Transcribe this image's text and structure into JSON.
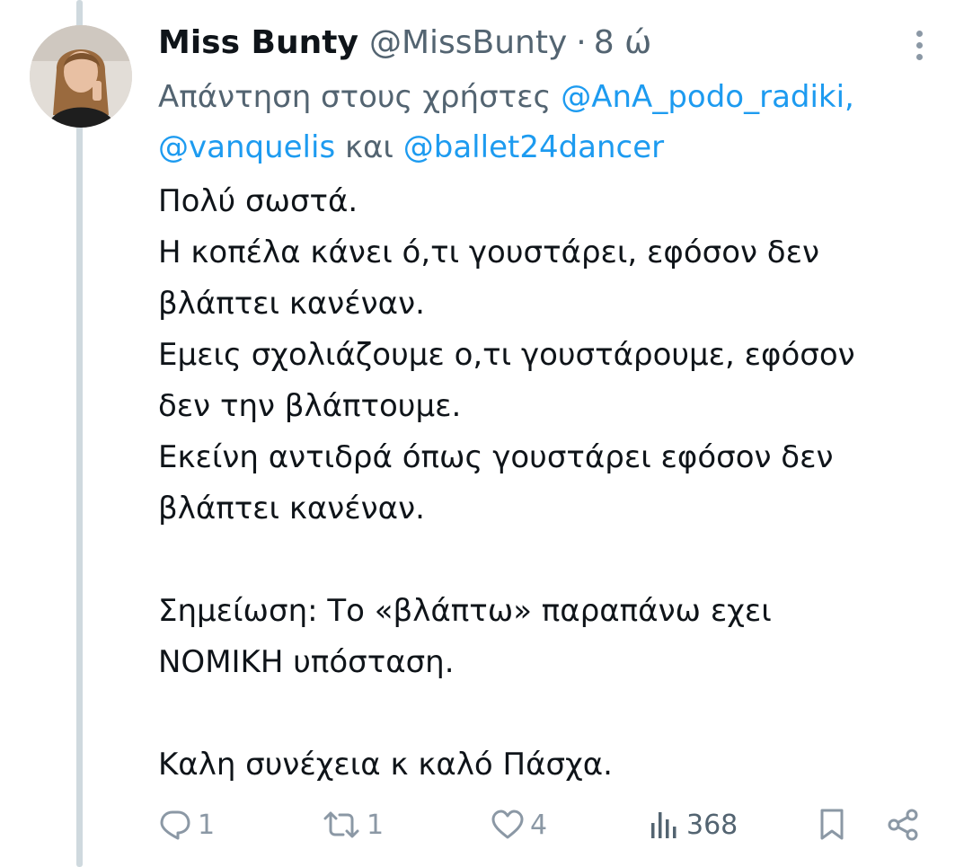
{
  "tweet": {
    "display_name": "Miss Bunty",
    "handle": "@MissBunty",
    "separator": "·",
    "time": "8 ώ",
    "reply_prefix": "Απάντηση στους χρήστες",
    "mentions": [
      "@AnA_podo_radiki,",
      "@vanquelis",
      "@ballet24dancer"
    ],
    "mention_joiner": "και",
    "body_lines": [
      "Πολύ σωστά.",
      "Η κοπέλα κάνει ό,τι γουστάρει, εφόσον δεν",
      "βλάπτει κανέναν.",
      "Εμεις σχολιάζουμε ο,τι γουστάρουμε, εφόσον",
      "δεν την βλάπτουμε.",
      "Εκείνη αντιδρά όπως γουστάρει εφόσον δεν",
      "βλάπτει κανέναν.",
      "",
      "Σημείωση: Το «βλάπτω» παραπάνω εχει",
      "ΝΟΜΙΚΗ υπόσταση.",
      "",
      "Καλη συνέχεια κ καλό Πάσχα."
    ]
  },
  "actions": {
    "replies": "1",
    "retweets": "1",
    "likes": "4",
    "views": "368"
  },
  "icons": {
    "reply": "reply-icon",
    "retweet": "retweet-icon",
    "like": "heart-icon",
    "views": "views-icon",
    "bookmark": "bookmark-icon",
    "share": "share-icon",
    "more": "more-vertical-icon"
  },
  "colors": {
    "link": "#1d9bf0",
    "muted": "#536471",
    "text": "#0f1419",
    "thread_line": "#cfd9de"
  }
}
